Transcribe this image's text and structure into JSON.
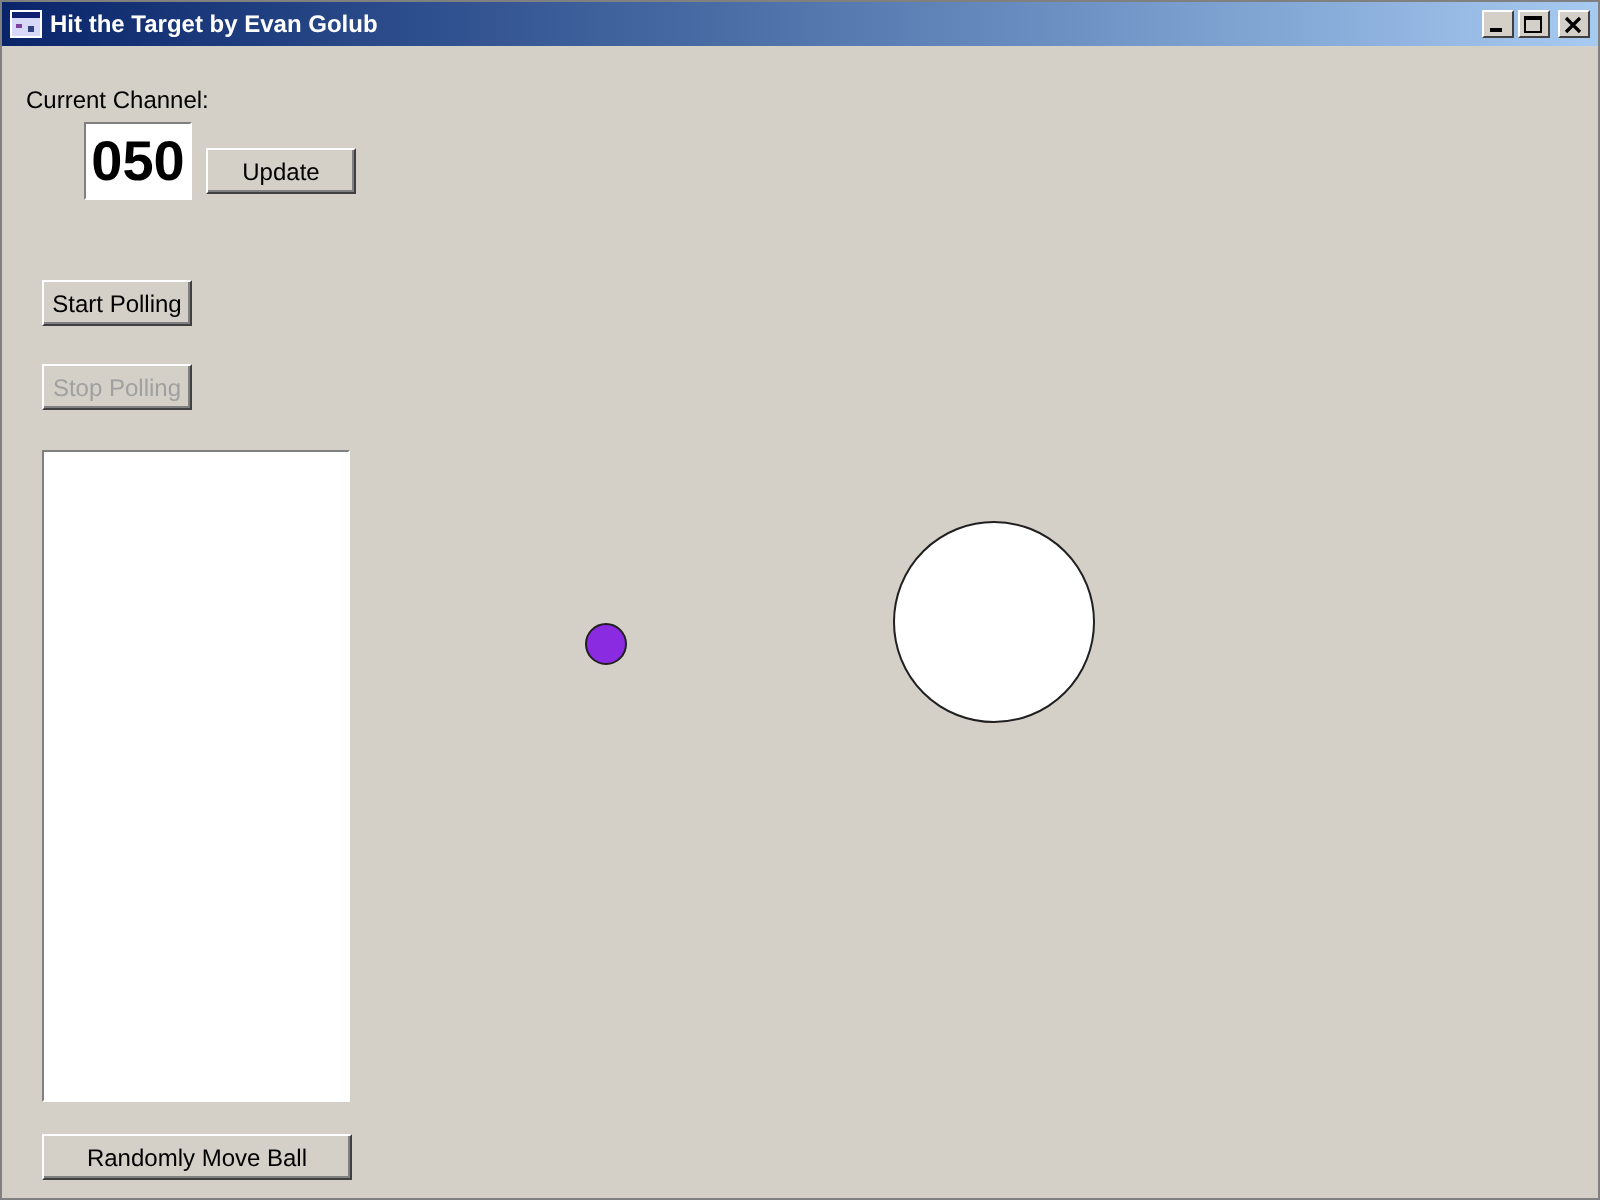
{
  "window": {
    "title": "Hit the Target by Evan Golub"
  },
  "channel": {
    "label": "Current Channel:",
    "value": "050"
  },
  "update_button": {
    "label": "Update",
    "disabled": false
  },
  "polling_buttons": [
    {
      "label": "Start Polling",
      "disabled": false
    },
    {
      "label": "Stop Polling",
      "disabled": true
    }
  ],
  "move_button": {
    "label": "Randomly Move Ball",
    "disabled": false
  }
}
